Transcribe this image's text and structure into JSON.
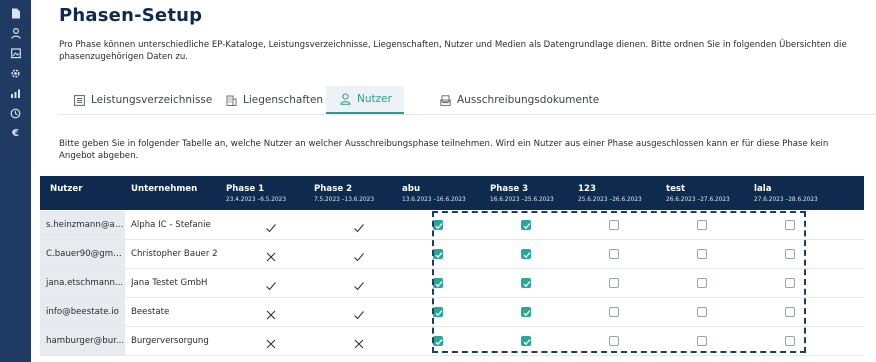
{
  "sidebar": {
    "icons": [
      "document-icon",
      "user-icon",
      "image-icon",
      "gear-icon",
      "chart-icon",
      "clock-icon",
      "euro-icon"
    ],
    "euro_glyph": "€"
  },
  "page": {
    "title": "Phasen-Setup",
    "intro": "Pro Phase können unterschiedliche EP-Kataloge, Leistungsverzeichnisse, Liegenschaften, Nutzer und Medien als Datengrundlage dienen. Bitte ordnen Sie in folgenden Übersichten die phasenzugehörigen Daten zu."
  },
  "tabs": [
    {
      "label": "Leistungsverzeichnisse",
      "icon": "list-icon",
      "active": false
    },
    {
      "label": "Liegenschaften",
      "icon": "building-icon",
      "active": false
    },
    {
      "label": "Nutzer",
      "icon": "user-icon",
      "active": true
    },
    {
      "label": "Ausschreibungsdokumente",
      "icon": "document-stack-icon",
      "active": false
    }
  ],
  "info_text": "Bitte geben Sie in folgender Tabelle an, welche Nutzer an welcher Ausschreibungsphase teilnehmen. Wird ein Nutzer aus einer Phase ausgeschlossen kann er für diese Phase kein Angebot abgeben.",
  "table": {
    "headers": {
      "user": "Nutzer",
      "company": "Unternehmen",
      "phases": [
        {
          "name": "Phase 1",
          "dates": "23.4.2023 –6.5.2023"
        },
        {
          "name": "Phase 2",
          "dates": "7.5.2023 –13.6.2023"
        },
        {
          "name": "abu",
          "dates": "13.6.2023 –16.6.2023"
        },
        {
          "name": "Phase 3",
          "dates": "16.6.2023 –25.6.2023"
        },
        {
          "name": "123",
          "dates": "25.6.2023 –26.6.2023"
        },
        {
          "name": "test",
          "dates": "26.6.2023 –27.6.2023"
        },
        {
          "name": "lala",
          "dates": "27.6.2023 –28.6.2023"
        }
      ]
    },
    "rows": [
      {
        "user": "s.heinzmann@al...",
        "company": "Alpha IC - Stefanie",
        "phase1": "check",
        "phase2": "check",
        "boxes": [
          true,
          true,
          false,
          false,
          false
        ]
      },
      {
        "user": "C.bauer90@gmx...",
        "company": "Christopher Bauer 2",
        "phase1": "cross",
        "phase2": "check",
        "boxes": [
          true,
          true,
          false,
          false,
          false
        ]
      },
      {
        "user": "jana.etschmann...",
        "company": "Jana Testet GmbH",
        "phase1": "check",
        "phase2": "check",
        "boxes": [
          true,
          true,
          false,
          false,
          false
        ]
      },
      {
        "user": "info@beestate.io",
        "company": "Beestate",
        "phase1": "cross",
        "phase2": "check",
        "boxes": [
          true,
          true,
          false,
          false,
          false
        ]
      },
      {
        "user": "hamburger@bur...",
        "company": "Burgerversorgung",
        "phase1": "cross",
        "phase2": "cross",
        "boxes": [
          true,
          true,
          false,
          false,
          false
        ]
      }
    ]
  },
  "colors": {
    "sidebar": "#1f3b64",
    "header": "#0f2a4f",
    "accent": "#2aa79b",
    "dashed_outline": "#1f3b64"
  }
}
